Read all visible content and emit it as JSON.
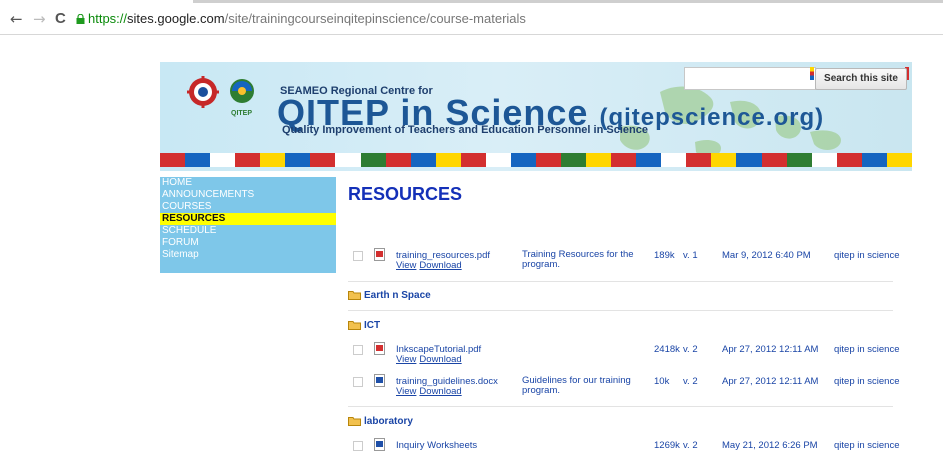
{
  "browser": {
    "url_protocol": "https://",
    "url_host": "sites.google.com",
    "url_path": "/site/trainingcourseinqitepinscience/course-materials",
    "back_glyph": "←",
    "forward_glyph": "→",
    "reload_glyph": "C"
  },
  "header": {
    "subtitle": "SEAMEO Regional Centre for",
    "brand": "QITEP in Science",
    "brand_site": "(qitepscience.org)",
    "tagline": "Quality Improvement of Teachers and Education Personnel in Science",
    "logo_caption": "QITEP",
    "search_placeholder": "",
    "search_button": "Search this site"
  },
  "sidebar": {
    "items": [
      {
        "label": "HOME"
      },
      {
        "label": "ANNOUNCEMENTS"
      },
      {
        "label": "COURSES"
      },
      {
        "label": "RESOURCES"
      },
      {
        "label": "SCHEDULE"
      },
      {
        "label": "FORUM"
      },
      {
        "label": "Sitemap"
      }
    ]
  },
  "main": {
    "title": "RESOURCES",
    "files": [
      {
        "name": "training_resources.pdf",
        "view": "View",
        "download": "Download",
        "desc": "Training Resources for the program.",
        "size": "189k",
        "version": "v. 1",
        "date": "Mar 9, 2012 6:40 PM",
        "user": "qitep in science"
      },
      {
        "name": "InkscapeTutorial.pdf",
        "view": "View",
        "download": "Download",
        "desc": "",
        "size": "2418k",
        "version": "v. 2",
        "date": "Apr 27, 2012 12:11 AM",
        "user": "qitep in science"
      },
      {
        "name": "training_guidelines.docx",
        "view": "View",
        "download": "Download",
        "desc": "Guidelines for our training program.",
        "size": "10k",
        "version": "v. 2",
        "date": "Apr 27, 2012 12:11 AM",
        "user": "qitep in science"
      },
      {
        "name": "Inquiry Worksheets",
        "view": "",
        "download": "",
        "desc": "",
        "size": "1269k",
        "version": "v. 2",
        "date": "May 21, 2012 6:26 PM",
        "user": "qitep in science"
      }
    ],
    "folders": [
      {
        "label": "Earth n Space"
      },
      {
        "label": "ICT"
      },
      {
        "label": "laboratory"
      }
    ]
  },
  "colors": {
    "sidebar_bg": "#7ec7e9",
    "active_bg": "#ffff00",
    "title_color": "#1430b8",
    "link_color": "#1a45a6"
  }
}
